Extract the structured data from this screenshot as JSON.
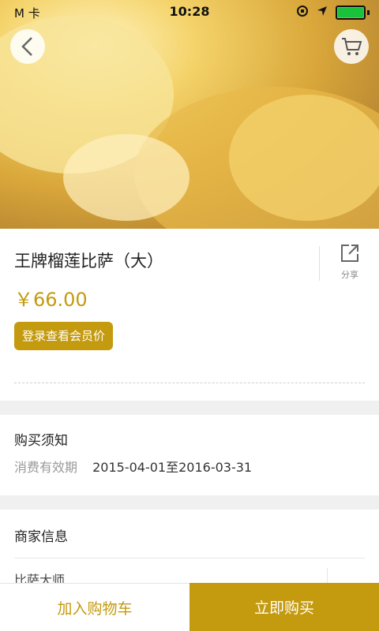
{
  "status_bar": {
    "carrier": "M 卡",
    "time": "10:28",
    "icons": [
      "wifi-icon",
      "orientation-lock-icon",
      "location-icon",
      "battery-icon"
    ]
  },
  "hero": {
    "image": "cheese-pizza-photo",
    "back_icon": "chevron-left-icon",
    "cart_icon": "cart-icon"
  },
  "product": {
    "name": "王牌榴莲比萨（大）",
    "price": "￥66.00",
    "member_button": "登录查看会员价",
    "share_label": "分享"
  },
  "purchase_notice": {
    "title": "购买须知",
    "validity_label": "消费有效期",
    "validity_value": "2015-04-01至2016-03-31"
  },
  "merchant": {
    "title": "商家信息",
    "name": "比萨大师"
  },
  "bottom_bar": {
    "add_to_cart": "加入购物车",
    "buy_now": "立即购买"
  },
  "colors": {
    "accent": "#c49a0f",
    "background": "#f0f0f0"
  }
}
